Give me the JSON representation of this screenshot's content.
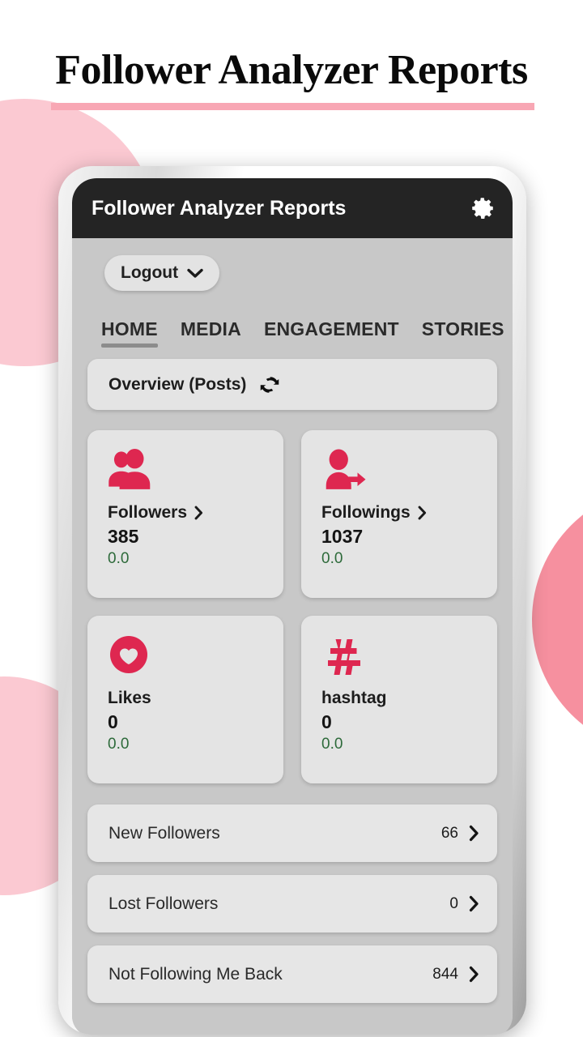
{
  "page": {
    "title": "Follower Analyzer Reports",
    "accent_pink": "#F8A7B4",
    "circle_light_pink": "#FBC9D2",
    "circle_deep_pink": "#F6909F",
    "brand_crimson": "#DE2750",
    "delta_green": "#2D6A3A"
  },
  "app_bar": {
    "title": "Follower Analyzer Reports",
    "settings_icon": "gear-icon"
  },
  "account": {
    "logout_label": "Logout",
    "dropdown_icon": "chevron-down-icon"
  },
  "tabs": [
    {
      "label": "HOME",
      "active": true
    },
    {
      "label": "MEDIA",
      "active": false
    },
    {
      "label": "ENGAGEMENT",
      "active": false
    },
    {
      "label": "STORIES",
      "active": false
    }
  ],
  "overview": {
    "label": "Overview (Posts)",
    "refresh_icon": "refresh-icon"
  },
  "stat_cards": [
    {
      "icon": "followers-icon",
      "title": "Followers",
      "value": "385",
      "delta": "0.0",
      "has_chevron": true
    },
    {
      "icon": "followings-icon",
      "title": "Followings",
      "value": "1037",
      "delta": "0.0",
      "has_chevron": true
    },
    {
      "icon": "heart-icon",
      "title": "Likes",
      "value": "0",
      "delta": "0.0",
      "has_chevron": false
    },
    {
      "icon": "hashtag-icon",
      "title": "hashtag",
      "value": "0",
      "delta": "0.0",
      "has_chevron": false
    }
  ],
  "list_rows": [
    {
      "label": "New Followers",
      "count": "66"
    },
    {
      "label": "Lost Followers",
      "count": "0"
    },
    {
      "label": "Not Following Me Back",
      "count": "844"
    }
  ]
}
